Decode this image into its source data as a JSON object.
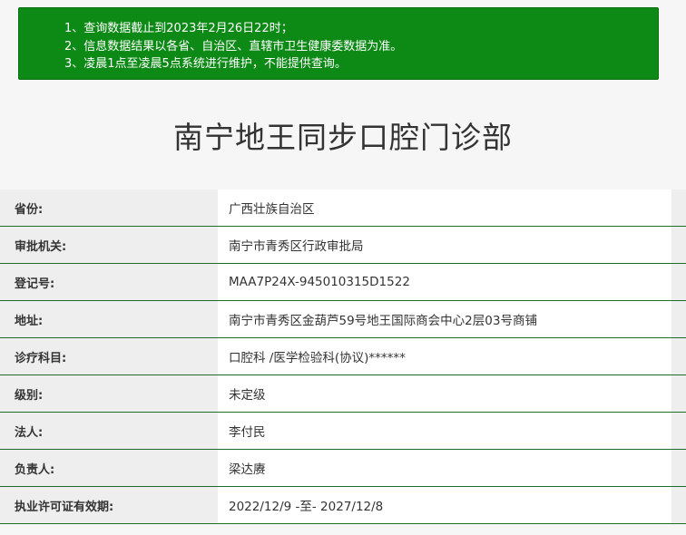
{
  "notice": {
    "lines": [
      "1、查询数据截止到2023年2月26日22时；",
      "2、信息数据结果以各省、自治区、直辖市卫生健康委数据为准。",
      "3、凌晨1点至凌晨5点系统进行维护，不能提供查询。"
    ],
    "background_color": "#0d8a16"
  },
  "page_title": "南宁地王同步口腔门诊部",
  "rows": [
    {
      "label": "省份:",
      "value": "广西壮族自治区"
    },
    {
      "label": "审批机关:",
      "value": "南宁市青秀区行政审批局"
    },
    {
      "label": "登记号:",
      "value": "MAA7P24X-945010315D1522"
    },
    {
      "label": "地址:",
      "value": "南宁市青秀区金葫芦59号地王国际商会中心2层03号商铺"
    },
    {
      "label": "诊疗科目:",
      "value": "口腔科 /医学检验科(协议)******"
    },
    {
      "label": "级别:",
      "value": "未定级"
    },
    {
      "label": "法人:",
      "value": "李付民"
    },
    {
      "label": "负责人:",
      "value": "梁达赓"
    },
    {
      "label": "执业许可证有效期:",
      "value": "2022/12/9 -至- 2027/12/8"
    }
  ],
  "colors": {
    "row_divider": "#1f6b2c",
    "label_bg": "#eeeeee",
    "value_bg": "#ffffff"
  }
}
